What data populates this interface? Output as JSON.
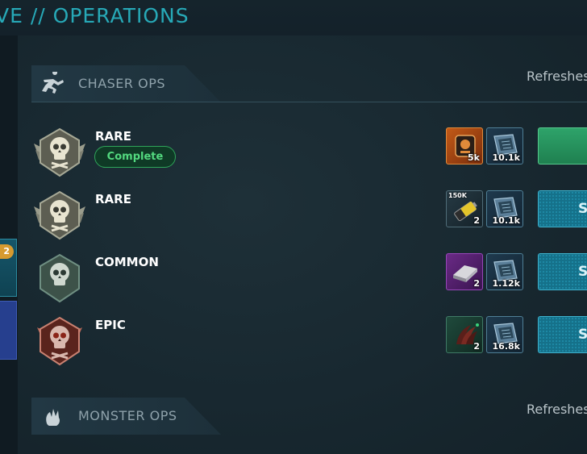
{
  "page": {
    "title": "VE // OPERATIONS"
  },
  "sidebar": {
    "badge_count": "2"
  },
  "sections": [
    {
      "title": "CHASER OPS",
      "icon": "runner-icon",
      "refresh_label": "Refreshes"
    },
    {
      "title": "MONSTER OPS",
      "icon": "monster-claw-icon",
      "refresh_label": "Refreshes"
    }
  ],
  "operations": [
    {
      "rarity": "RARE",
      "status": "Complete",
      "medal_color": "#8f8f80",
      "rewards": [
        {
          "icon": "dog-tag-crate-icon",
          "qty": "5k",
          "style": "orange"
        },
        {
          "icon": "data-chip-icon",
          "qty": "10.1k",
          "style": "blue"
        }
      ],
      "action": {
        "state": "complete",
        "label": ""
      }
    },
    {
      "rarity": "RARE",
      "status": "",
      "medal_color": "#8f8f80",
      "rewards": [
        {
          "icon": "battery-icon",
          "top_label": "150K",
          "qty": "2",
          "style": "dark"
        },
        {
          "icon": "data-chip-icon",
          "qty": "10.1k",
          "style": "blue"
        }
      ],
      "action": {
        "state": "start",
        "label": "S"
      }
    },
    {
      "rarity": "COMMON",
      "status": "",
      "medal_color": "#5d8074",
      "rewards": [
        {
          "icon": "metal-bar-icon",
          "qty": "2",
          "style": "purple"
        },
        {
          "icon": "data-chip-icon",
          "qty": "1.12k",
          "style": "blue"
        }
      ],
      "action": {
        "state": "start",
        "label": "S"
      }
    },
    {
      "rarity": "EPIC",
      "status": "",
      "medal_color": "#8a3a2e",
      "rewards": [
        {
          "icon": "claw-trophy-icon",
          "qty": "2",
          "style": "green"
        },
        {
          "icon": "data-chip-icon",
          "qty": "16.8k",
          "style": "blue"
        }
      ],
      "action": {
        "state": "start",
        "label": "S"
      }
    }
  ]
}
